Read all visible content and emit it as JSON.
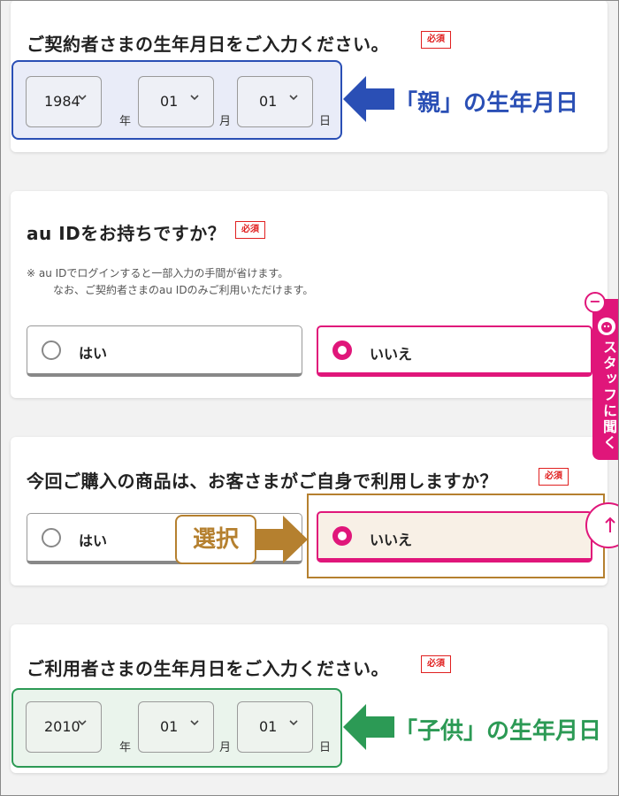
{
  "required_badge": "必須",
  "contract_birth": {
    "title": "ご契約者さまの生年月日をご入力ください。",
    "year": "1984",
    "month": "01",
    "day": "01",
    "annotation": "「親」の生年月日"
  },
  "units": {
    "year": "年",
    "month": "月",
    "day": "日"
  },
  "auid": {
    "title": "au IDをお持ちですか？",
    "note_line1": "※  au IDでログインすると一部入力の手間が省けます。",
    "note_line2": "なお、ご契約者さまのau IDのみご利用いただけます。",
    "option_yes": "はい",
    "option_no": "いいえ",
    "selected": "いいえ"
  },
  "self_use": {
    "title": "今回ご購入の商品は、お客さまがご自身で利用しますか？",
    "option_yes": "はい",
    "option_no": "いいえ",
    "selected": "いいえ",
    "annotation": "選択"
  },
  "user_birth": {
    "title": "ご利用者さまの生年月日をご入力ください。",
    "year": "2010",
    "month": "01",
    "day": "01",
    "annotation": "「子供」の生年月日"
  },
  "staff_tab": {
    "label": "スタッフに聞く"
  },
  "colors": {
    "accent_pink": "#e0167a",
    "annotation_blue": "#2a4fb5",
    "annotation_green": "#2c9a55",
    "annotation_orange": "#b5802f",
    "required_red": "#e02020"
  },
  "icons": [
    "chevron-down-icon",
    "radio-icon",
    "arrow-left-icon",
    "arrow-right-icon",
    "staff-face-icon",
    "minus-icon",
    "arrow-up-icon"
  ]
}
